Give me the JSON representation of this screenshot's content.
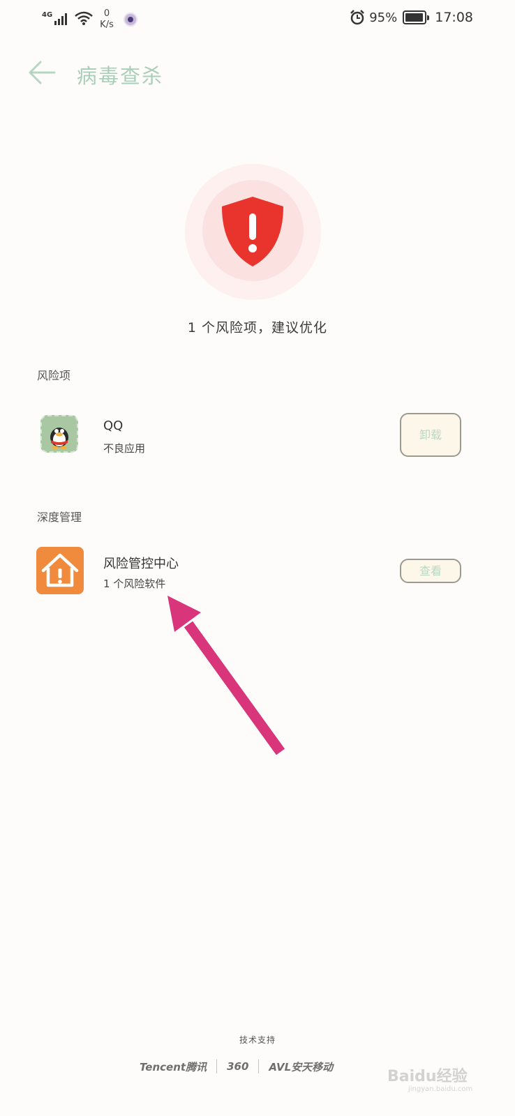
{
  "status_bar": {
    "network": "4G",
    "speed_value": "0",
    "speed_unit": "K/s",
    "battery_percent": "95%",
    "time": "17:08",
    "battery_level": 0.95
  },
  "header": {
    "title": "病毒查杀"
  },
  "hero": {
    "summary": "1 个风险项，建议优化",
    "accent_color": "#e8342c"
  },
  "risk_section": {
    "label": "风险项",
    "items": [
      {
        "app_name": "QQ",
        "description": "不良应用",
        "action_label": "卸载"
      }
    ]
  },
  "deep_section": {
    "label": "深度管理",
    "items": [
      {
        "title": "风险管控中心",
        "description": "1 个风险软件",
        "action_label": "查看",
        "icon": "house-warning-icon"
      }
    ]
  },
  "footer": {
    "tech_support": "技术支持",
    "partners": [
      "Tencent腾讯",
      "360",
      "AVL安天移动"
    ]
  },
  "watermark": {
    "brand": "Baidu经验",
    "url": "jingyan.baidu.com"
  }
}
